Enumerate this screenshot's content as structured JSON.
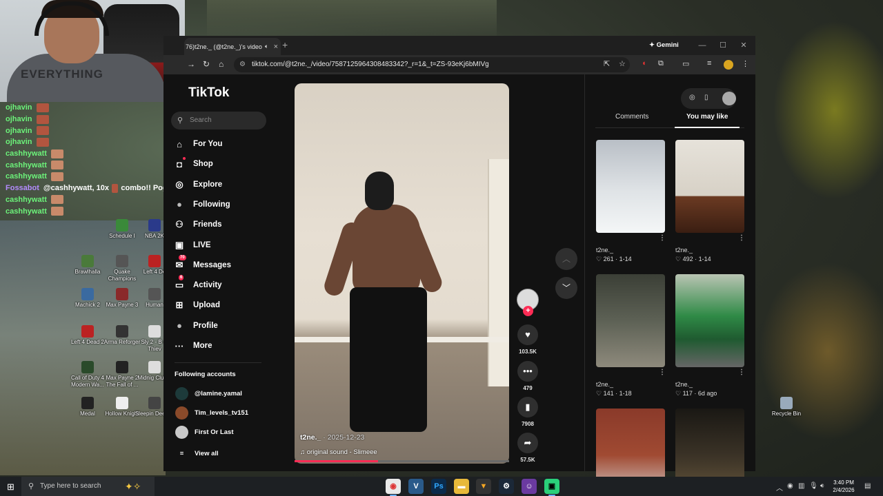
{
  "stream": {
    "webcam_shirt_text": "EVERYTHING",
    "chat": [
      {
        "user": "ojhavin",
        "msg": "",
        "emote": "block"
      },
      {
        "user": "ojhavin",
        "msg": "",
        "emote": "block"
      },
      {
        "user": "ojhavin",
        "msg": "",
        "emote": "block"
      },
      {
        "user": "ojhavin",
        "msg": "",
        "emote": "block"
      },
      {
        "user": "cashhywatt",
        "msg": "",
        "emote": "face"
      },
      {
        "user": "cashhywatt",
        "msg": "",
        "emote": "face"
      },
      {
        "user": "cashhywatt",
        "msg": "",
        "emote": "face"
      },
      {
        "user": "Fossabot",
        "msg": "@cashhywatt, 10x",
        "emote": "block",
        "tail": "combo!! PogChamp /"
      },
      {
        "user": "cashhywatt",
        "msg": "",
        "emote": "face"
      },
      {
        "user": "cashhywatt",
        "msg": "",
        "emote": "face"
      }
    ]
  },
  "desktop": {
    "icons": [
      {
        "label": "Schedule I",
        "color": "#3a8a3a"
      },
      {
        "label": "NBA 2K",
        "color": "#2a3a8a"
      },
      {
        "label": "Brawlhalla",
        "color": "#4a7a3a"
      },
      {
        "label": "Quake Champions",
        "color": "#555"
      },
      {
        "label": "Left 4 De",
        "color": "#b22"
      },
      {
        "label": "Machick 2",
        "color": "#3a6aa0"
      },
      {
        "label": "Max Payne 3",
        "color": "#8a2a2a"
      },
      {
        "label": "Human",
        "color": "#555"
      },
      {
        "label": "Left 4 Dead 2",
        "color": "#b22"
      },
      {
        "label": "Arma Reforger",
        "color": "#333"
      },
      {
        "label": "Sly 2 - B of Thiev",
        "color": "#ddd"
      },
      {
        "label": "Call of Duty 4 Modern Wa...",
        "color": "#2a4a2a"
      },
      {
        "label": "Max Payne 2 The Fall of ...",
        "color": "#222"
      },
      {
        "label": "Midnig Club 3",
        "color": "#ddd"
      },
      {
        "label": "Medal",
        "color": "#222"
      },
      {
        "label": "Hollow Knight",
        "color": "#eee"
      },
      {
        "label": "Sleepin Deep D",
        "color": "#444"
      },
      {
        "label": "Recycle Bin",
        "color": "#9ab"
      }
    ]
  },
  "browser": {
    "tab_title": "76)t2ne._ (@t2ne._)'s video",
    "tab_close": "×",
    "new_tab": "+",
    "gemini_label": "✦ Gemini",
    "url": "tiktok.com/@t2ne._/video/7587125964308483342?_r=1&_t=ZS-93eKj6bMIVg"
  },
  "tiktok": {
    "logo": "TikTok",
    "search_placeholder": "Search",
    "nav": [
      {
        "label": "For You",
        "icon": "home-icon"
      },
      {
        "label": "Shop",
        "icon": "shop-icon"
      },
      {
        "label": "Explore",
        "icon": "compass-icon"
      },
      {
        "label": "Following",
        "icon": "following-icon"
      },
      {
        "label": "Friends",
        "icon": "friends-icon"
      },
      {
        "label": "LIVE",
        "icon": "live-icon"
      },
      {
        "label": "Messages",
        "icon": "messages-icon",
        "badge": "70"
      },
      {
        "label": "Activity",
        "icon": "activity-icon",
        "badge": "6"
      },
      {
        "label": "Upload",
        "icon": "upload-icon"
      },
      {
        "label": "Profile",
        "icon": "profile-icon"
      },
      {
        "label": "More",
        "icon": "more-icon"
      }
    ],
    "following_accounts_title": "Following accounts",
    "accounts": [
      {
        "name": "@lamine.yamal"
      },
      {
        "name": "Tim_levels_tv151"
      },
      {
        "name": "First Or Last"
      }
    ],
    "view_all": "View all",
    "video": {
      "username": "t2ne._",
      "date": " · 2025-12-23",
      "sound": "♫  original sound - Slimeee",
      "progress": 0.39
    },
    "actions": {
      "likes": "103.5K",
      "comments": "479",
      "saves": "7908",
      "shares": "57.5K"
    },
    "panel": {
      "tab_comments": "Comments",
      "tab_you_may_like": "You may like",
      "thumbs": [
        {
          "user": "t2ne._",
          "stats": "♡ 261 · 1-14",
          "bg": "snow"
        },
        {
          "user": "t2ne._",
          "stats": "♡ 492 · 1-14",
          "bg": "room"
        },
        {
          "user": "t2ne._",
          "stats": "♡ 141 · 1-18",
          "bg": "room2"
        },
        {
          "user": "t2ne._",
          "stats": "♡ 117 · 6d ago",
          "bg": "green"
        },
        {
          "user": "",
          "stats": "",
          "bg": "brick"
        },
        {
          "user": "",
          "stats": "",
          "bg": "dark"
        }
      ]
    }
  },
  "taskbar": {
    "search_placeholder": "Type here to search",
    "time": "3:40 PM",
    "date": "2/4/2026"
  }
}
